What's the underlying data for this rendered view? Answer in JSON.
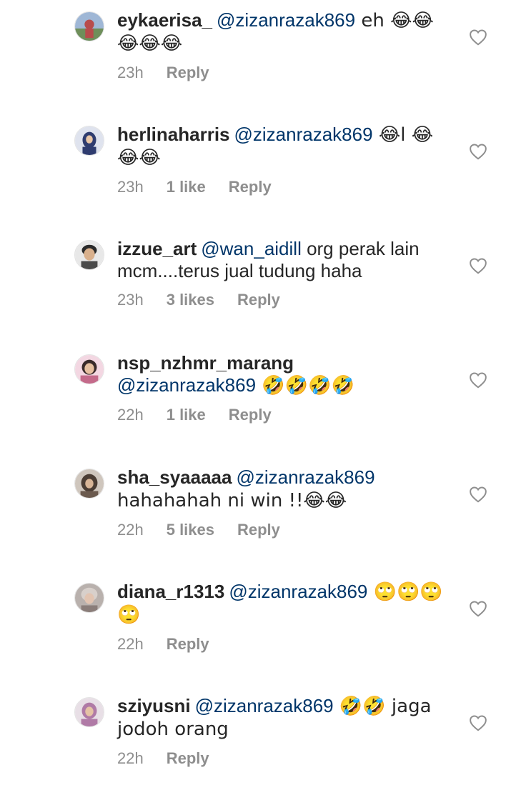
{
  "comments": [
    {
      "username": "eykaerisa_",
      "mention": "@zizanrazak869",
      "text": " eh 😂😂😂😂😂",
      "time": "23h",
      "likes": "",
      "reply": "Reply",
      "avatar_color": "#b84c4c"
    },
    {
      "username": "herlinaharris",
      "mention": "@zizanrazak869",
      "text": " 😂l 😂😂😂",
      "time": "23h",
      "likes": "1 like",
      "reply": "Reply",
      "avatar_color": "#2f3c6f"
    },
    {
      "username": "izzue_art",
      "mention": "@wan_aidill",
      "text": " org perak lain mcm....terus jual tudung haha",
      "time": "23h",
      "likes": "3 likes",
      "reply": "Reply",
      "avatar_color": "#4a4a4a"
    },
    {
      "username": "nsp_nzhmr_marang",
      "mention": "@zizanrazak869",
      "text": " 🤣🤣🤣🤣",
      "time": "22h",
      "likes": "1 like",
      "reply": "Reply",
      "avatar_color": "#c46a8a"
    },
    {
      "username": "sha_syaaaaa",
      "mention": "@zizanrazak869",
      "text": " hahahahah ni win !!😂😂",
      "time": "22h",
      "likes": "5 likes",
      "reply": "Reply",
      "avatar_color": "#6b5a4e"
    },
    {
      "username": "diana_r1313",
      "mention": "@zizanrazak869",
      "text": " 🙄🙄🙄🙄",
      "time": "22h",
      "likes": "",
      "reply": "Reply",
      "avatar_color": "#8a7d79"
    },
    {
      "username": "sziyusni",
      "mention": "@zizanrazak869",
      "text": " 🤣🤣 jaga jodoh orang",
      "time": "22h",
      "likes": "",
      "reply": "Reply",
      "avatar_color": "#b07aa6"
    }
  ]
}
